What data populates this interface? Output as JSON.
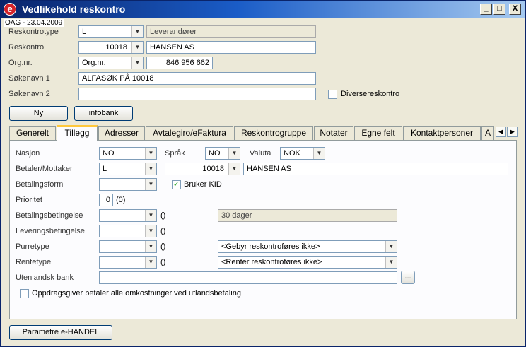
{
  "window": {
    "title": "Vedlikehold reskontro",
    "app_icon_letter": "e",
    "min": "_",
    "max": "□",
    "close": "X"
  },
  "stamp": "OAG - 23.04.2009",
  "header": {
    "reskontrotype_label": "Reskontrotype",
    "reskontrotype_value": "L",
    "reskontrotype_desc": "Leverandører",
    "reskontro_label": "Reskontro",
    "reskontro_value": "10018",
    "reskontro_name": "HANSEN AS",
    "orgnr_label": "Org.nr.",
    "orgnr_type": "Org.nr.",
    "orgnr_value": "846 956 662",
    "sokenavn1_label": "Søkenavn 1",
    "sokenavn1_value": "ALFASØK PÅ 10018",
    "sokenavn2_label": "Søkenavn 2",
    "sokenavn2_value": "",
    "diverse_label": "Diversereskontro",
    "diverse_checked": false
  },
  "buttons": {
    "ny": "Ny",
    "infobank": "infobank",
    "parametre": "Parametre e-HANDEL"
  },
  "tabs": [
    {
      "label": "Generelt",
      "active": false
    },
    {
      "label": "Tillegg",
      "active": true
    },
    {
      "label": "Adresser",
      "active": false
    },
    {
      "label": "Avtalegiro/eFaktura",
      "active": false
    },
    {
      "label": "Reskontrogruppe",
      "active": false
    },
    {
      "label": "Notater",
      "active": false
    },
    {
      "label": "Egne felt",
      "active": false
    },
    {
      "label": "Kontaktpersoner",
      "active": false
    },
    {
      "label": "A",
      "active": false
    }
  ],
  "tab_nav": {
    "prev": "◀",
    "next": "▶"
  },
  "tillegg": {
    "nasjon_label": "Nasjon",
    "nasjon_value": "NO",
    "sprak_label": "Språk",
    "sprak_value": "NO",
    "valuta_label": "Valuta",
    "valuta_value": "NOK",
    "betaler_label": "Betaler/Mottaker",
    "betaler_type": "L",
    "betaler_nr": "10018",
    "betaler_name": "HANSEN AS",
    "betalingsform_label": "Betalingsform",
    "betalingsform_value": "",
    "bruker_kid_label": "Bruker KID",
    "bruker_kid_checked": true,
    "prioritet_label": "Prioritet",
    "prioritet_value": "0",
    "prioritet_paren": "(0)",
    "betalingsbetingelse_label": "Betalingsbetingelse",
    "betalingsbetingelse_paren": "()",
    "betalingsbetingelse_desc": "30 dager",
    "leveringsbetingelse_label": "Leveringsbetingelse",
    "leveringsbetingelse_paren": "()",
    "purretype_label": "Purretype",
    "purretype_paren": "()",
    "purretype_option": "<Gebyr reskontroføres ikke>",
    "rentetype_label": "Rentetype",
    "rentetype_paren": "()",
    "rentetype_option": "<Renter reskontroføres ikke>",
    "utenlandsk_label": "Utenlandsk bank",
    "utenlandsk_value": "",
    "browse": "...",
    "oppdragsgiver_label": "Oppdragsgiver betaler alle omkostninger ved utlandsbetaling",
    "oppdragsgiver_checked": false
  },
  "icons": {
    "dropdown": "dropdown-arrow-icon",
    "check": "checkmark-icon"
  }
}
